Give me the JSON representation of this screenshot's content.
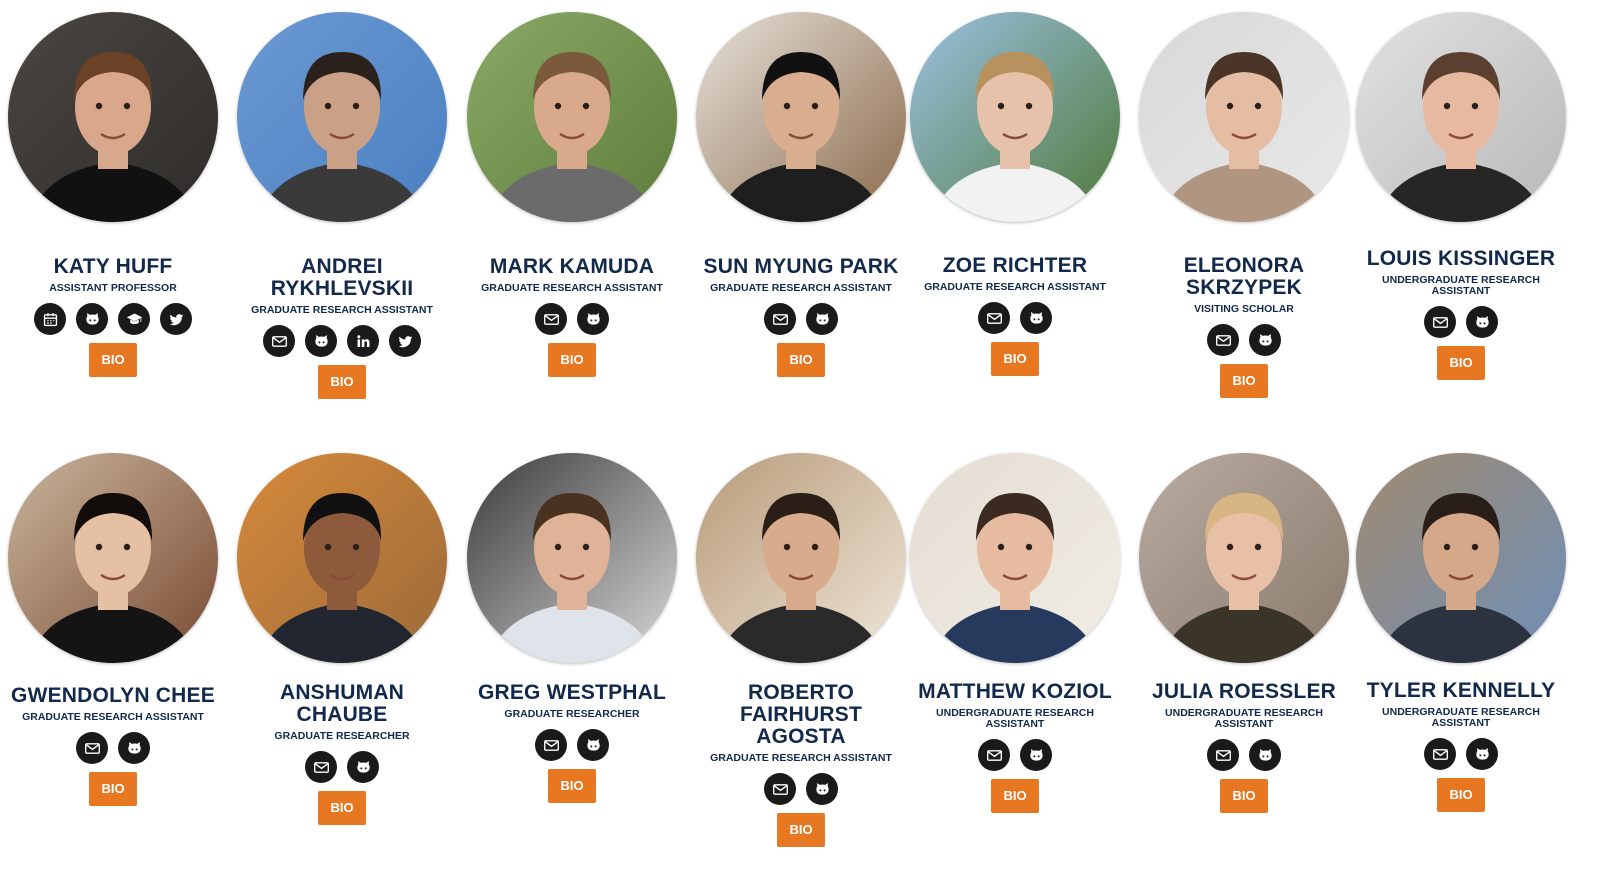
{
  "people": [
    {
      "name": "KATY HUFF",
      "role": "ASSISTANT PROFESSOR",
      "bio_label": "BIO",
      "links": [
        "calendar-icon",
        "github-icon",
        "graduation-cap-icon",
        "twitter-icon"
      ],
      "photo_colors": {
        "bg": "#2e2c29",
        "bg2": "#4a4642",
        "skin": "#d9a78c",
        "hair": "#6b4226",
        "shirt": "#111111"
      }
    },
    {
      "name": "ANDREI RYKHLEVSKII",
      "role": "GRADUATE RESEARCH ASSISTANT",
      "bio_label": "BIO",
      "links": [
        "email-icon",
        "github-icon",
        "linkedin-icon",
        "twitter-icon"
      ],
      "photo_colors": {
        "bg": "#4a7fc1",
        "bg2": "#6b9ad3",
        "skin": "#caa086",
        "hair": "#2a211c",
        "shirt": "#3a3a3a"
      }
    },
    {
      "name": "MARK KAMUDA",
      "role": "GRADUATE RESEARCH ASSISTANT",
      "bio_label": "BIO",
      "links": [
        "email-icon",
        "github-icon"
      ],
      "photo_colors": {
        "bg": "#5e7d3a",
        "bg2": "#8aa866",
        "skin": "#d8a98a",
        "hair": "#7a5a3a",
        "shirt": "#6b6b6b"
      }
    },
    {
      "name": "SUN MYUNG PARK",
      "role": "GRADUATE RESEARCH ASSISTANT",
      "bio_label": "BIO",
      "links": [
        "email-icon",
        "github-icon"
      ],
      "photo_colors": {
        "bg": "#8b6a4a",
        "bg2": "#e6e1da",
        "skin": "#d8ae8e",
        "hair": "#111111",
        "shirt": "#1e1e1e"
      }
    },
    {
      "name": "ZOE RICHTER",
      "role": "GRADUATE RESEARCH ASSISTANT",
      "bio_label": "BIO",
      "links": [
        "email-icon",
        "github-icon"
      ],
      "photo_colors": {
        "bg": "#4f7a3a",
        "bg2": "#9cc0e2",
        "skin": "#e6c2aa",
        "hair": "#b8925e",
        "shirt": "#f2f2f2"
      }
    },
    {
      "name": "ELEONORA SKRZYPEK",
      "role": "VISITING SCHOLAR",
      "bio_label": "BIO",
      "links": [
        "email-icon",
        "github-icon"
      ],
      "photo_colors": {
        "bg": "#e9e9e9",
        "bg2": "#d8d8d8",
        "skin": "#e4bda3",
        "hair": "#4a3528",
        "shirt": "#b09680"
      }
    },
    {
      "name": "LOUIS KISSINGER",
      "role": "UNDERGRADUATE RESEARCH ASSISTANT",
      "bio_label": "BIO",
      "links": [
        "email-icon",
        "github-icon"
      ],
      "photo_colors": {
        "bg": "#b7b7b7",
        "bg2": "#e2e2e2",
        "skin": "#e7b9a0",
        "hair": "#5b4030",
        "shirt": "#262626"
      }
    },
    {
      "name": "GWENDOLYN CHEE",
      "role": "GRADUATE RESEARCH ASSISTANT",
      "bio_label": "BIO",
      "links": [
        "email-icon",
        "github-icon"
      ],
      "photo_colors": {
        "bg": "#7a4a33",
        "bg2": "#c9b59c",
        "skin": "#e6c0a3",
        "hair": "#120d0b",
        "shirt": "#141414"
      }
    },
    {
      "name": "ANSHUMAN CHAUBE",
      "role": "GRADUATE RESEARCHER",
      "bio_label": "BIO",
      "links": [
        "email-icon",
        "github-icon"
      ],
      "photo_colors": {
        "bg": "#9a6a3a",
        "bg2": "#d88a3a",
        "skin": "#8e5a3c",
        "hair": "#111111",
        "shirt": "#222630"
      }
    },
    {
      "name": "GREG WESTPHAL",
      "role": "GRADUATE RESEARCHER",
      "bio_label": "BIO",
      "links": [
        "email-icon",
        "github-icon"
      ],
      "photo_colors": {
        "bg": "#d9d9d9",
        "bg2": "#3a3a3a",
        "skin": "#e0b298",
        "hair": "#4a3220",
        "shirt": "#dfe4ea"
      }
    },
    {
      "name": "ROBERTO FAIRHURST AGOSTA",
      "role": "GRADUATE RESEARCH ASSISTANT",
      "bio_label": "BIO",
      "links": [
        "email-icon",
        "github-icon"
      ],
      "photo_colors": {
        "bg": "#efe6d8",
        "bg2": "#b89b7a",
        "skin": "#d8ab8c",
        "hair": "#2b1e16",
        "shirt": "#2a2a2a"
      }
    },
    {
      "name": "MATTHEW KOZIOL",
      "role": "UNDERGRADUATE RESEARCH ASSISTANT",
      "bio_label": "BIO",
      "links": [
        "email-icon",
        "github-icon"
      ],
      "photo_colors": {
        "bg": "#f1ede6",
        "bg2": "#e4ddd2",
        "skin": "#e7bba0",
        "hair": "#3b2a20",
        "shirt": "#263a5e"
      }
    },
    {
      "name": "JULIA ROESSLER",
      "role": "UNDERGRADUATE RESEARCH ASSISTANT",
      "bio_label": "BIO",
      "links": [
        "email-icon",
        "github-icon"
      ],
      "photo_colors": {
        "bg": "#8a7a6e",
        "bg2": "#b9aba0",
        "skin": "#e8c0a6",
        "hair": "#d8b684",
        "shirt": "#3a3528"
      }
    },
    {
      "name": "TYLER KENNELLY",
      "role": "UNDERGRADUATE RESEARCH ASSISTANT",
      "bio_label": "BIO",
      "links": [
        "email-icon",
        "github-icon"
      ],
      "photo_colors": {
        "bg": "#6e8fb8",
        "bg2": "#a08a70",
        "skin": "#d6a88a",
        "hair": "#2a1e18",
        "shirt": "#2c3340"
      }
    }
  ]
}
